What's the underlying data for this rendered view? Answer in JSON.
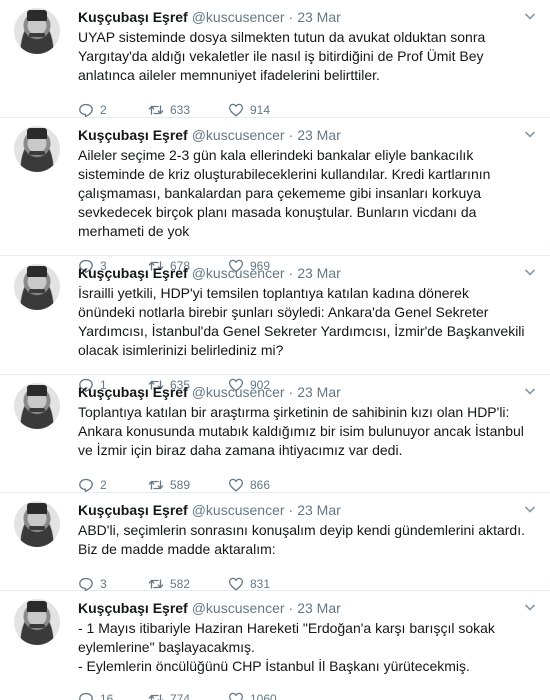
{
  "colors": {
    "text": "#14171a",
    "secondary": "#657786",
    "border": "#e6ecf0"
  },
  "icons": {
    "reply": "reply-icon",
    "retweet": "retweet-icon",
    "like": "heart-icon",
    "menu": "chevron-down-icon",
    "avatar": "profile-avatar"
  },
  "tweets": [
    {
      "name": "Kuşçubaşı Eşref",
      "handle": "@kuscusencer",
      "dot": "·",
      "time": "23 Mar",
      "text": "UYAP sisteminde dosya silmekten tutun da avukat olduktan sonra Yargıtay'da aldığı vekaletler ile nasıl iş bitirdiğini de Prof Ümit Bey anlatınca aileler memnuniyet ifadelerini belirttiler.",
      "replies": "2",
      "retweets": "633",
      "likes": "914"
    },
    {
      "name": "Kuşçubaşı Eşref",
      "handle": "@kuscusencer",
      "dot": "·",
      "time": "23 Mar",
      "text": "Aileler seçime 2-3 gün kala ellerindeki bankalar eliyle bankacılık sisteminde de kriz oluşturabileceklerini kullandılar. Kredi kartlarının çalışmaması, bankalardan para çekememe gibi insanları korkuya sevkedecek birçok planı masada konuştular. Bunların vicdanı da merhameti de yok",
      "replies": "3",
      "retweets": "678",
      "likes": "969"
    },
    {
      "name": "Kuşçubaşı Eşref",
      "handle": "@kuscusencer",
      "dot": "·",
      "time": "23 Mar",
      "text": "İsrailli yetkili, HDP'yi temsilen toplantıya katılan kadına dönerek önündeki notlarla birebir şunları söyledi: Ankara'da Genel Sekreter Yardımcısı, İstanbul'da Genel Sekreter Yardımcısı, İzmir'de Başkanvekili olacak isimlerinizi belirlediniz mi?",
      "replies": "1",
      "retweets": "635",
      "likes": "902"
    },
    {
      "name": "Kuşçubaşı Eşref",
      "handle": "@kuscusencer",
      "dot": "·",
      "time": "23 Mar",
      "text": "Toplantıya katılan bir araştırma şirketinin de sahibinin kızı olan HDP'li: Ankara konusunda mutabık kaldığımız bir isim bulunuyor ancak İstanbul ve İzmir için biraz daha zamana ihtiyacımız var dedi.",
      "replies": "2",
      "retweets": "589",
      "likes": "866"
    },
    {
      "name": "Kuşçubaşı Eşref",
      "handle": "@kuscusencer",
      "dot": "·",
      "time": "23 Mar",
      "text": "ABD'li, seçimlerin sonrasını konuşalım deyip kendi gündemlerini aktardı. Biz de madde madde aktaralım:",
      "replies": "3",
      "retweets": "582",
      "likes": "831"
    },
    {
      "name": "Kuşçubaşı Eşref",
      "handle": "@kuscusencer",
      "dot": "·",
      "time": "23 Mar",
      "text_lines": [
        "- 1 Mayıs itibariyle Haziran Hareketi \"Erdoğan'a karşı barışçıl sokak eylemlerine\" başlayacakmış.",
        "- Eylemlerin öncülüğünü CHP İstanbul İl Başkanı yürütecekmiş."
      ],
      "replies": "16",
      "retweets": "774",
      "likes": "1060"
    }
  ]
}
